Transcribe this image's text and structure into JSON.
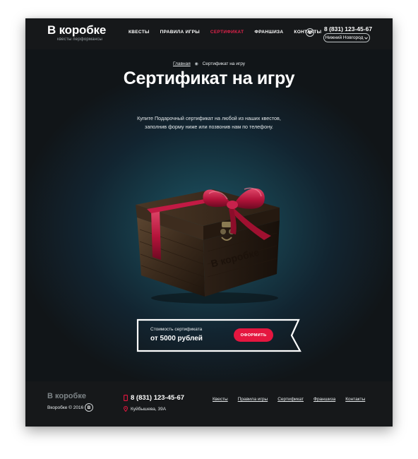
{
  "header": {
    "logo": "В коробке",
    "logo_sub": "квесты перформансы",
    "nav": [
      "Квесты",
      "Правила игры",
      "Сертификат",
      "Франшиза",
      "Контакты"
    ],
    "vk": "B",
    "phone": "8 (831) 123-45-67",
    "city": "Нижний Новгород"
  },
  "hero": {
    "breadcrumb_home": "Главная",
    "breadcrumb_current": "Сертификат на игру",
    "title": "Сертификат на игру",
    "desc_line1": "Купите Подарочный сертификат на любой из наших квестов,",
    "desc_line2": "заполнив форму ниже или позвонив нам по телефону.",
    "box_engraving": "В коробке",
    "price_label": "Стоимость сертификата",
    "price_value": "от 5000 рублей",
    "order_button": "ОФОРМИТЬ"
  },
  "footer": {
    "logo": "В коробке",
    "copyright": "Вкоробке © 2016",
    "vk": "B",
    "phone": "8 (831) 123-45-67",
    "address": "Куйбышева, 39А",
    "nav": [
      "Квесты",
      "Правила игры",
      "Сертификат",
      "Франшиза",
      "Контакты"
    ]
  },
  "colors": {
    "accent": "#e5163f",
    "background": "#141617",
    "teal_glow": "#1f5566"
  }
}
